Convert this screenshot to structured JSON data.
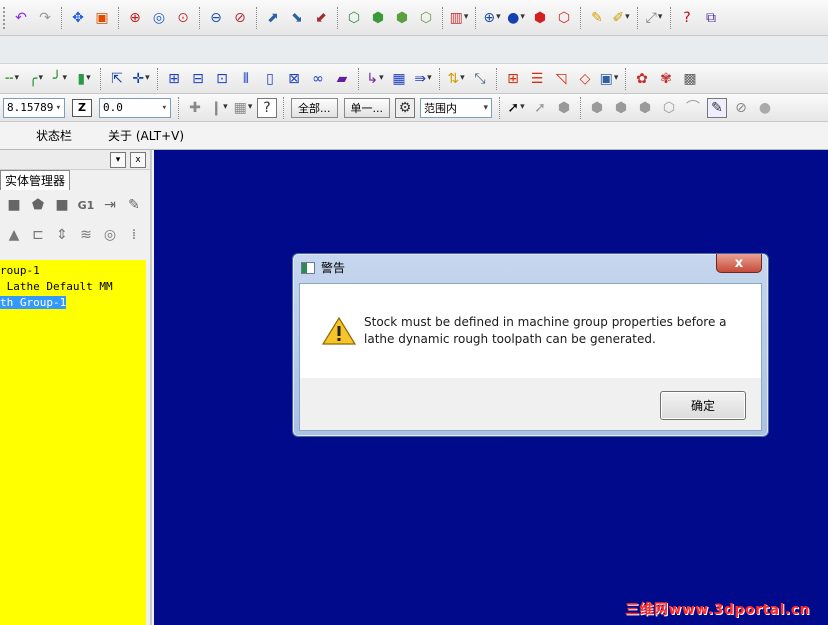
{
  "toolbar1": {
    "icons": [
      "undo-icon",
      "redo-icon",
      "pan-icon",
      "fit-icon",
      "zoom-window-icon",
      "zoom-target-icon",
      "zoom-in-icon",
      "zoom-out-icon",
      "zoom-prev-icon",
      "gview-icon",
      "cplane-icon",
      "tplane-icon",
      "wire-cube-icon",
      "shaded-cube-icon",
      "solid-cube-icon",
      "iso-cube-icon",
      "view-box-icon",
      "globe-icon",
      "sphere-icon",
      "solid-red-icon",
      "solid-outline-icon",
      "pencil-icon",
      "analyze-icon",
      "dimension-icon",
      "help-icon",
      "plugin-icon"
    ]
  },
  "toolbar3": {
    "icons": [
      "line-icon",
      "fillet-icon",
      "chamfer-icon",
      "cylinder-icon",
      "arrow-icon",
      "point-icon",
      "trim-icon",
      "break-icon",
      "join-icon",
      "mirror-icon",
      "rotate-icon",
      "scale-icon",
      "offset-icon",
      "translate-icon",
      "xform-icon",
      "array-icon",
      "drag-icon",
      "light-icon",
      "ruler-icon",
      "table-icon",
      "list-icon",
      "page-icon",
      "tag-icon",
      "box-icon",
      "paint-icon",
      "brush-icon",
      "grid-icon"
    ]
  },
  "toolbar4": {
    "coord_value": "8.15789",
    "z_label": "Z",
    "z_value": "0.0",
    "all_button": "全部...",
    "single_button": "单一...",
    "range_select": "范围内",
    "icons": [
      "pointer-icon",
      "select-chain-icon",
      "solid-sel-icon",
      "gray-hex-1-icon",
      "gray-hex-2-icon",
      "gray-hex-3-icon",
      "cube-sel-icon",
      "arch-icon",
      "mask-icon",
      "no-icon"
    ]
  },
  "menu": {
    "items": [
      "状态栏",
      "关于 (ALT+V)"
    ]
  },
  "panel": {
    "tab_label": "实体管理器",
    "tree": [
      "roup-1",
      " Lathe Default MM",
      "th Group-1"
    ]
  },
  "dialog": {
    "title": "警告",
    "close": "x",
    "message_line1": "Stock must be defined in machine group properties before a",
    "message_line2": "lathe dynamic rough toolpath can be generated.",
    "ok": "确定"
  },
  "watermark": "三维网www.3dportal.cn"
}
